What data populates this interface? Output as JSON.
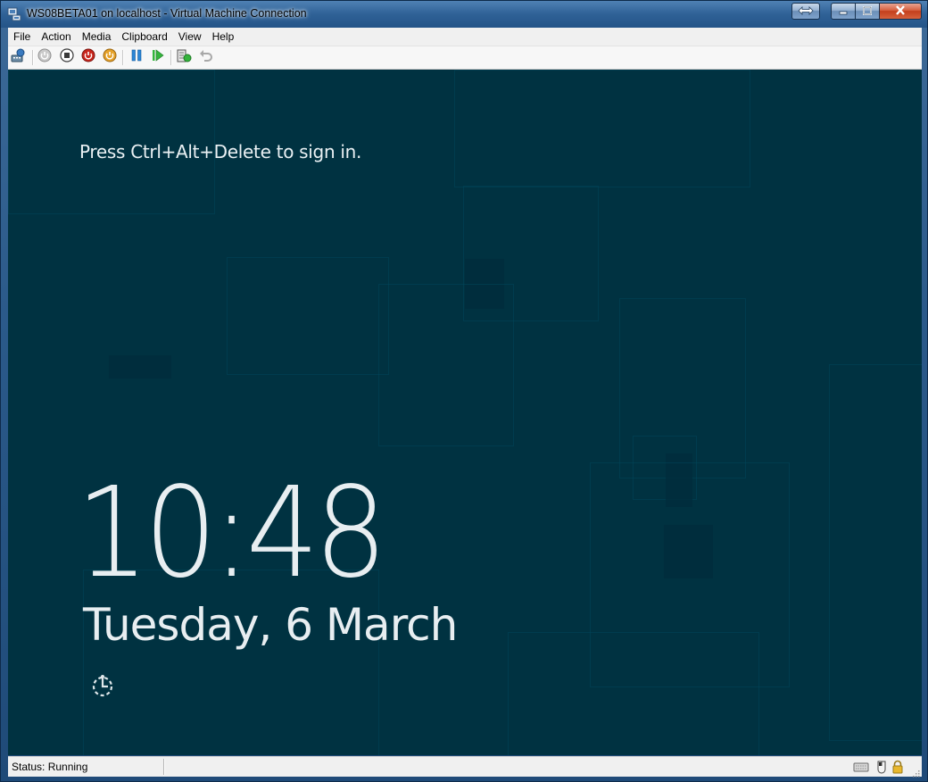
{
  "window": {
    "title": "WS08BETA01 on localhost - Virtual Machine Connection"
  },
  "menu": {
    "items": [
      "File",
      "Action",
      "Media",
      "Clipboard",
      "View",
      "Help"
    ]
  },
  "toolbar": {
    "buttons": [
      {
        "icon": "ctrl-alt-del-icon"
      },
      {
        "icon": "start-icon"
      },
      {
        "icon": "turn-off-icon"
      },
      {
        "icon": "shut-down-icon"
      },
      {
        "icon": "save-icon"
      },
      {
        "icon": "pause-icon"
      },
      {
        "icon": "reset-icon"
      },
      {
        "icon": "snapshot-icon"
      },
      {
        "icon": "revert-icon"
      }
    ]
  },
  "vm": {
    "prompt": "Press Ctrl+Alt+Delete to sign in.",
    "time": "10:48",
    "date": "Tuesday, 6 March",
    "background_color": "#003241",
    "ease_icon": "ease-of-access-icon"
  },
  "status": {
    "text": "Status: Running",
    "icons": [
      "keyboard-icon",
      "mouse-icon",
      "lock-icon"
    ]
  }
}
